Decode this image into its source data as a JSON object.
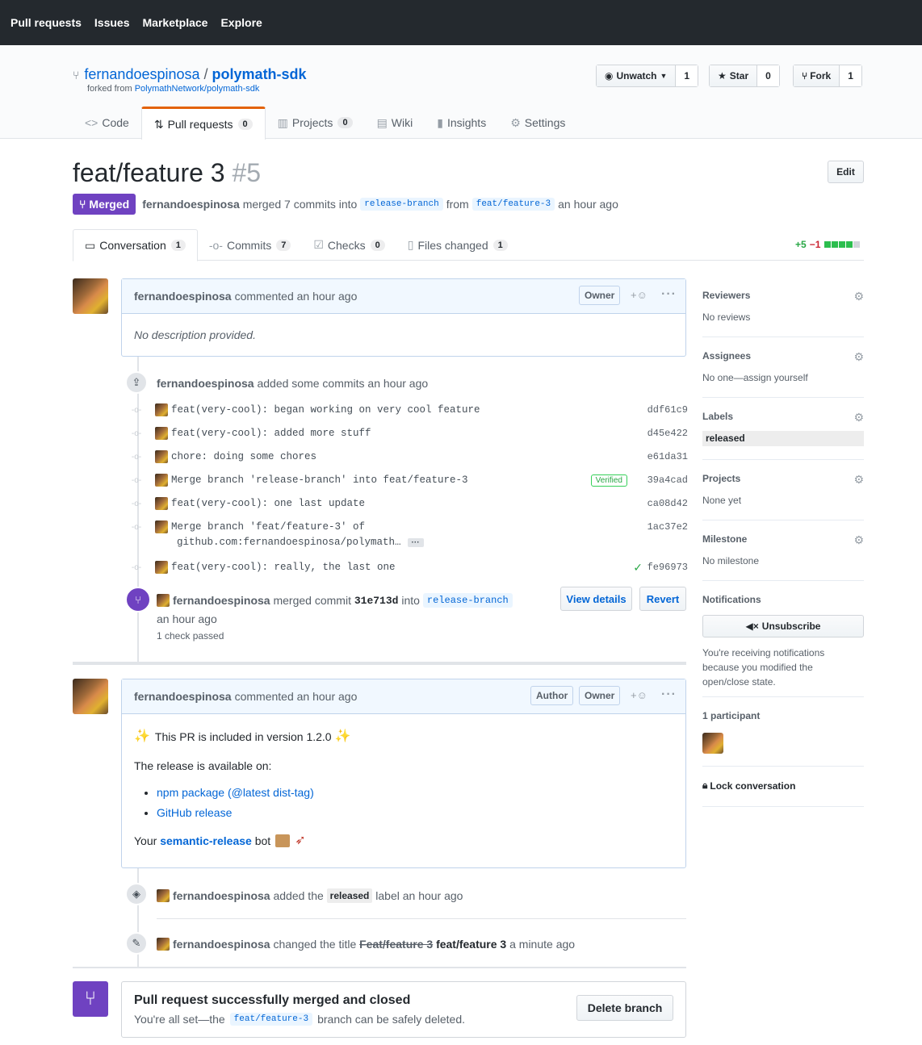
{
  "topnav": [
    "Pull requests",
    "Issues",
    "Marketplace",
    "Explore"
  ],
  "repo": {
    "owner": "fernandoespinosa",
    "separator": "/",
    "name": "polymath-sdk",
    "forked_prefix": "forked from",
    "forked_from": "PolymathNetwork/polymath-sdk",
    "unwatch_label": "Unwatch",
    "unwatch_count": "1",
    "star_label": "Star",
    "star_count": "0",
    "fork_label": "Fork",
    "fork_count": "1"
  },
  "reponav": {
    "code": "Code",
    "pulls": "Pull requests",
    "pulls_count": "0",
    "projects": "Projects",
    "projects_count": "0",
    "wiki": "Wiki",
    "insights": "Insights",
    "settings": "Settings"
  },
  "pr": {
    "title": "feat/feature 3",
    "number": "#5",
    "edit_label": "Edit",
    "state": "Merged",
    "author": "fernandoespinosa",
    "merged_text": "merged 7 commits into",
    "base_branch": "release-branch",
    "from_text": "from",
    "head_branch": "feat/feature-3",
    "time": "an hour ago"
  },
  "tabs": {
    "conversation": "Conversation",
    "conversation_count": "1",
    "commits": "Commits",
    "commits_count": "7",
    "checks": "Checks",
    "checks_count": "0",
    "files": "Files changed",
    "files_count": "1"
  },
  "diffstat": {
    "additions": "+5",
    "deletions": "−1"
  },
  "comment1": {
    "author": "fernandoespinosa",
    "action": "commented an hour ago",
    "role": "Owner",
    "body": "No description provided."
  },
  "commits_event": {
    "author": "fernandoespinosa",
    "action": "added some commits an hour ago",
    "items": [
      {
        "msg": "feat(very-cool): began working on very cool feature",
        "sha": "ddf61c9"
      },
      {
        "msg": "feat(very-cool): added more stuff",
        "sha": "d45e422"
      },
      {
        "msg": "chore: doing some chores",
        "sha": "e61da31"
      },
      {
        "msg": "Merge branch 'release-branch' into feat/feature-3",
        "sha": "39a4cad",
        "verified": "Verified"
      },
      {
        "msg": "feat(very-cool): one last update",
        "sha": "ca08d42"
      },
      {
        "msg": "Merge branch 'feat/feature-3' of",
        "msg2": "github.com:fernandoespinosa/polymath…",
        "sha": "1ac37e2"
      },
      {
        "msg": "feat(very-cool): really, the last one",
        "sha": "fe96973"
      }
    ]
  },
  "merge_event": {
    "author": "fernandoespinosa",
    "text1": "merged commit",
    "sha": "31e713d",
    "text2": "into",
    "branch": "release-branch",
    "time": "an hour ago",
    "checks": "1 check passed",
    "view_details": "View details",
    "revert": "Revert"
  },
  "comment2": {
    "author": "fernandoespinosa",
    "action": "commented an hour ago",
    "role_author": "Author",
    "role_owner": "Owner",
    "line1": "This PR is included in version 1.2.0",
    "line2": "The release is available on:",
    "link1": "npm package (@latest dist-tag)",
    "link2": "GitHub release",
    "your": "Your",
    "bot_link": "semantic-release",
    "bot": "bot"
  },
  "label_event": {
    "author": "fernandoespinosa",
    "text1": "added the",
    "label": "released",
    "text2": "label an hour ago"
  },
  "rename_event": {
    "author": "fernandoespinosa",
    "text1": "changed the title",
    "old": "Feat/feature 3",
    "new": "feat/feature 3",
    "time": "a minute ago"
  },
  "merged_box": {
    "title": "Pull request successfully merged and closed",
    "text1": "You're all set—the",
    "branch": "feat/feature-3",
    "text2": "branch can be safely deleted.",
    "delete_label": "Delete branch"
  },
  "sidebar": {
    "reviewers": "Reviewers",
    "reviewers_val": "No reviews",
    "assignees": "Assignees",
    "assignees_val": "No one—assign yourself",
    "labels": "Labels",
    "label_val": "released",
    "projects": "Projects",
    "projects_val": "None yet",
    "milestone": "Milestone",
    "milestone_val": "No milestone",
    "notifications": "Notifications",
    "unsubscribe": "Unsubscribe",
    "notif_text": "You're receiving notifications because you modified the open/close state.",
    "participants": "1 participant",
    "lock": "Lock conversation"
  }
}
